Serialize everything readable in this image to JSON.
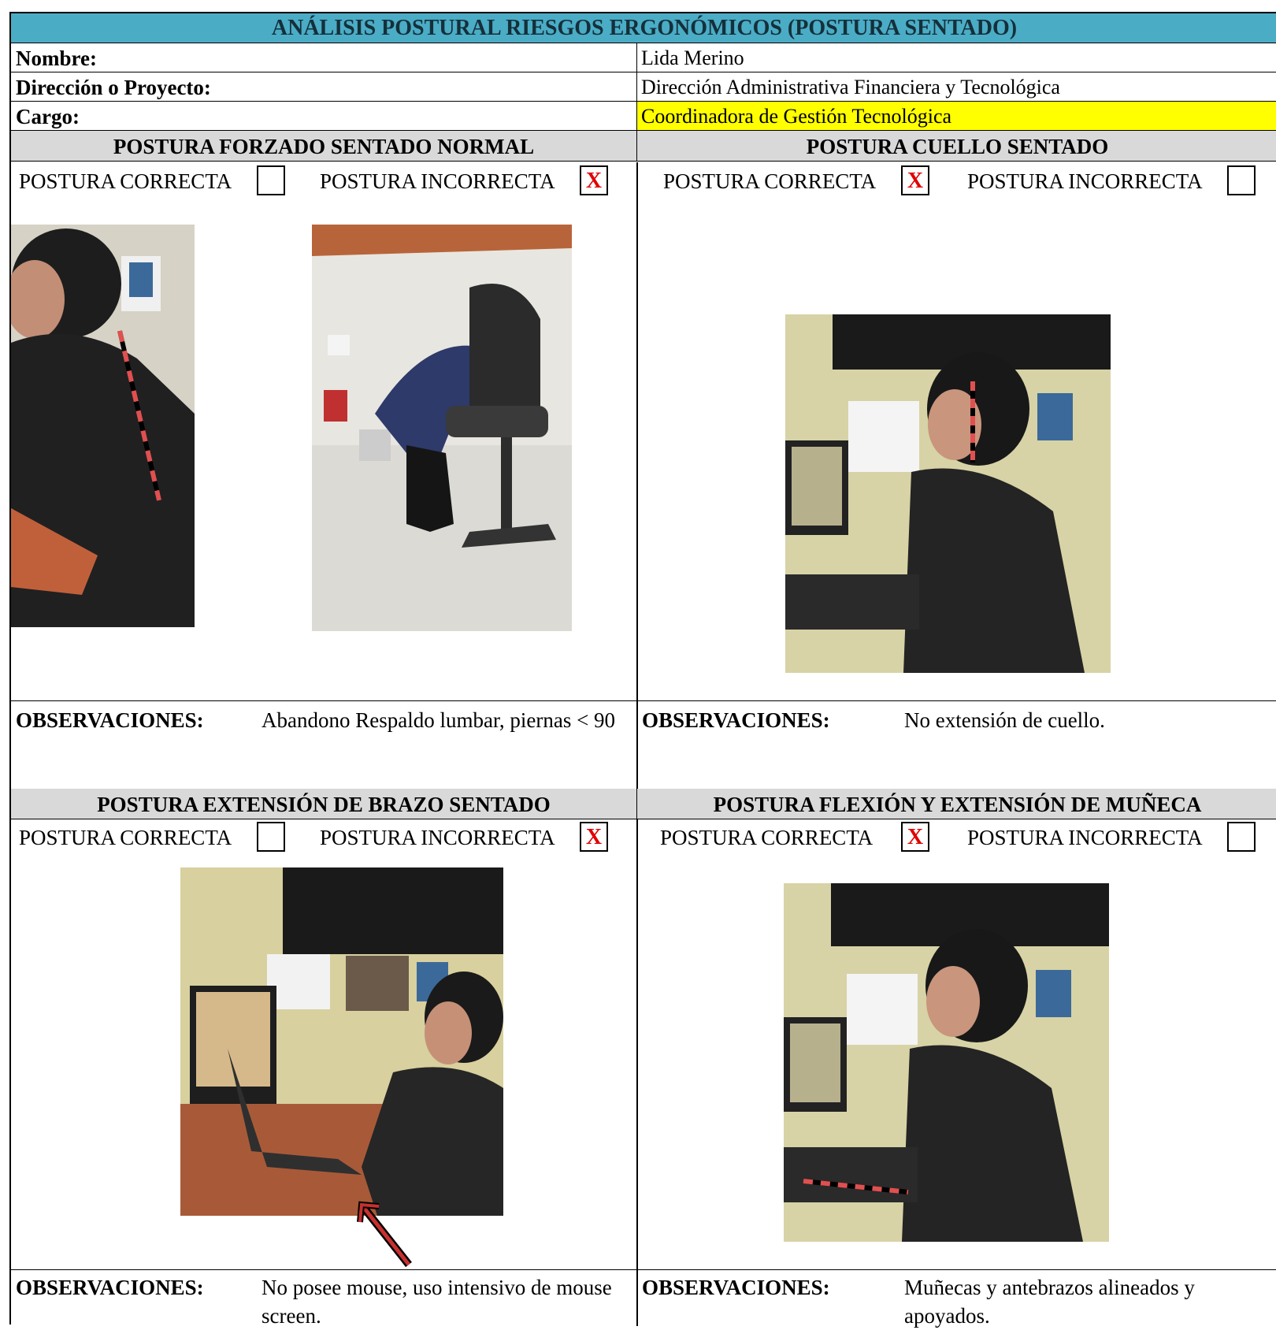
{
  "title": "ANÁLISIS POSTURAL RIESGOS ERGONÓMICOS (POSTURA SENTADO)",
  "info": [
    {
      "label": "Nombre:",
      "value": "Lida Merino"
    },
    {
      "label": "Dirección o Proyecto:",
      "value": "Dirección Administrativa Financiera y Tecnológica"
    },
    {
      "label": "Cargo:",
      "value": "Coordinadora de Gestión Tecnológica"
    }
  ],
  "options": {
    "correct": "POSTURA CORRECTA",
    "incorrect": "POSTURA INCORRECTA",
    "mark": "X"
  },
  "sections": [
    {
      "title": "POSTURA FORZADO SENTADO NORMAL",
      "correct_marked": false,
      "incorrect_marked": true,
      "obs_label": "OBSERVACIONES:",
      "obs_text": "Abandono Respaldo lumbar, piernas < 90"
    },
    {
      "title": "POSTURA CUELLO SENTADO",
      "correct_marked": true,
      "incorrect_marked": false,
      "obs_label": "OBSERVACIONES:",
      "obs_text": "No extensión de cuello."
    },
    {
      "title": "POSTURA EXTENSIÓN DE BRAZO SENTADO",
      "correct_marked": false,
      "incorrect_marked": true,
      "obs_label": "OBSERVACIONES:",
      "obs_text": "No posee mouse, uso intensivo de mouse screen."
    },
    {
      "title": "POSTURA FLEXIÓN Y EXTENSIÓN DE MUÑECA",
      "correct_marked": true,
      "incorrect_marked": false,
      "obs_label": "OBSERVACIONES:",
      "obs_text": "Muñecas y antebrazos alineados y apoyados."
    }
  ],
  "colors": {
    "header": "#4bacc6",
    "section": "#d9d9d9",
    "highlight": "#ffff00",
    "mark": "#e00000"
  }
}
